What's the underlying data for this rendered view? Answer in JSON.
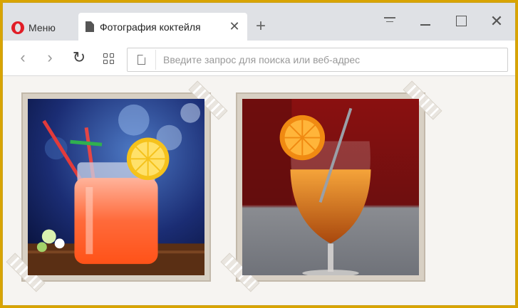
{
  "browser": {
    "menu_label": "Меню",
    "tab_title": "Фотография коктейля",
    "tab_close_glyph": "✕",
    "new_tab_glyph": "+",
    "close_glyph": "✕"
  },
  "toolbar": {
    "back_glyph": "‹",
    "forward_glyph": "›",
    "reload_glyph": "↻",
    "address_placeholder": "Введите запрос для поиска или веб-адрес",
    "address_value": ""
  },
  "icons": {
    "opera": "opera-logo-icon",
    "tab_page": "document-icon",
    "address_page": "page-icon",
    "speed_dial": "grid-icon"
  },
  "colors": {
    "frame_border": "#d9a400",
    "tabstrip": "#dfe1e5",
    "opera_red": "#e11d27",
    "page_bg": "#f6f4f1"
  }
}
